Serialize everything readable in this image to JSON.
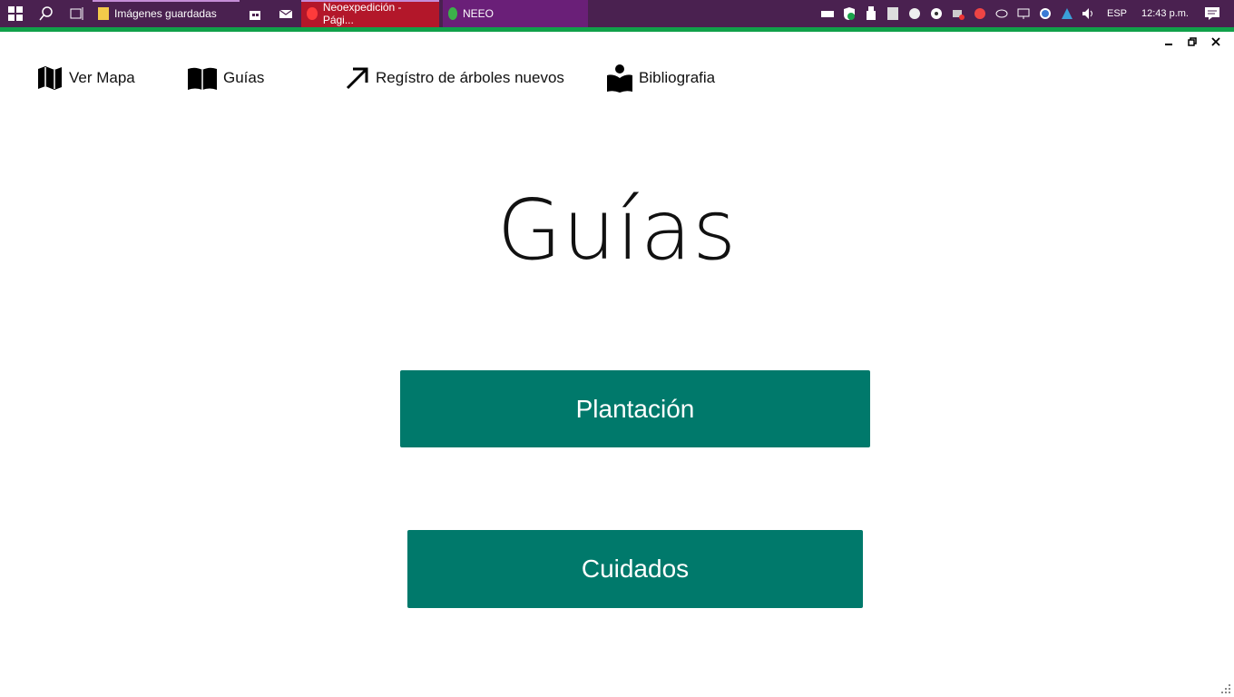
{
  "taskbar": {
    "tasks": [
      {
        "label": "Imágenes guardadas"
      },
      {
        "label": "Neoexpedición - Pági..."
      },
      {
        "label": "NEEO"
      }
    ],
    "language": "ESP",
    "clock": "12:43 p.m."
  },
  "nav": {
    "items": [
      {
        "label": "Ver Mapa"
      },
      {
        "label": "Guías"
      },
      {
        "label": "Regístro de árboles nuevos"
      },
      {
        "label": "Bibliografia"
      }
    ]
  },
  "page": {
    "title": "Guías"
  },
  "buttons": {
    "plantacion": "Plantación",
    "cuidados": "Cuidados"
  },
  "colors": {
    "taskbar": "#4a2150",
    "accent_strip": "#10a04a",
    "button": "#00796b"
  }
}
